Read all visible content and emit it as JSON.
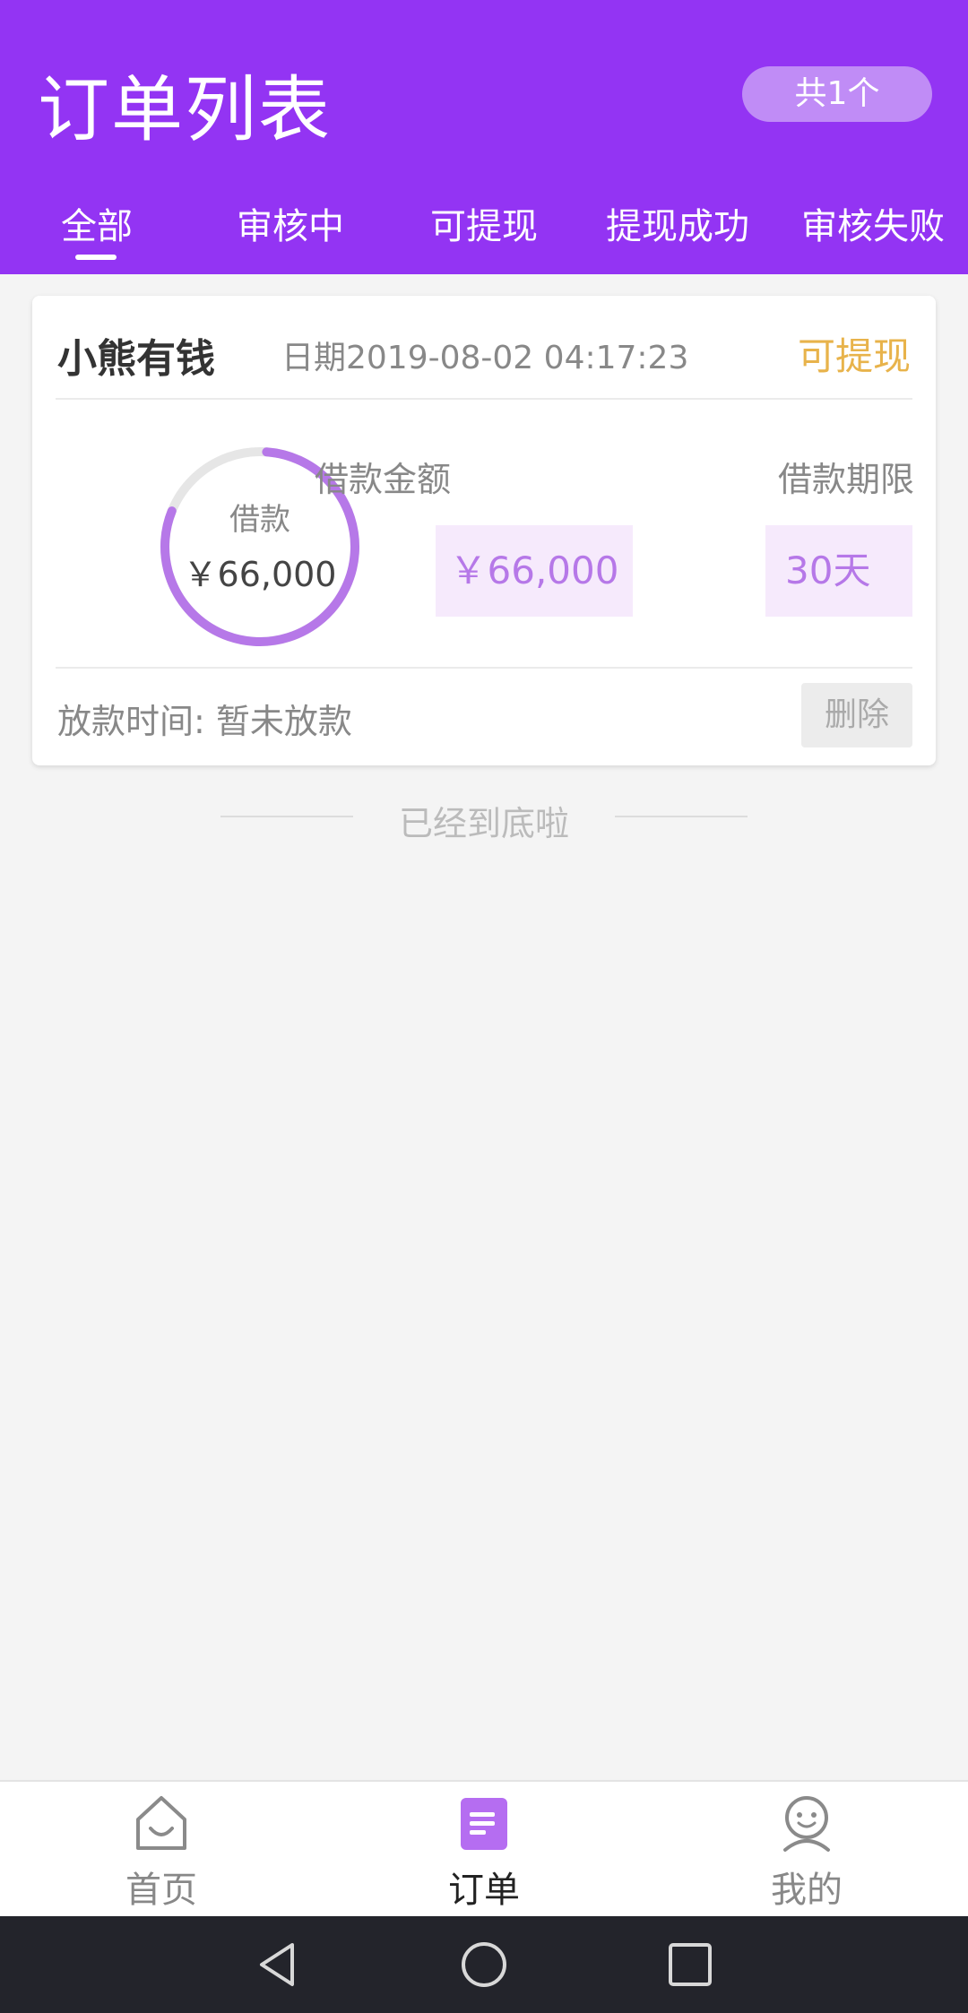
{
  "header": {
    "title": "订单列表",
    "count_badge": "共1个",
    "tabs": [
      "全部",
      "审核中",
      "可提现",
      "提现成功",
      "审核失败"
    ],
    "active_tab_index": 0
  },
  "order": {
    "name": "小熊有钱",
    "date": "日期2019-08-02 04:17:23",
    "status": "可提现",
    "ring_label": "借款",
    "ring_amount": "￥66,000",
    "ring_progress": 0.8,
    "amount_label": "借款金额",
    "amount_value": "￥66,000",
    "term_label": "借款期限",
    "term_value": "30天",
    "release_time": "放款时间: 暂未放款",
    "delete_label": "删除"
  },
  "end_text": "已经到底啦",
  "bottom_nav": [
    {
      "label": "首页",
      "icon": "home-icon",
      "active": false
    },
    {
      "label": "订单",
      "icon": "order-icon",
      "active": true
    },
    {
      "label": "我的",
      "icon": "profile-icon",
      "active": false
    }
  ],
  "colors": {
    "primary": "#9334f3",
    "accent_light": "#c08cf6",
    "status": "#e8b34b",
    "value_text": "#b678e8"
  }
}
